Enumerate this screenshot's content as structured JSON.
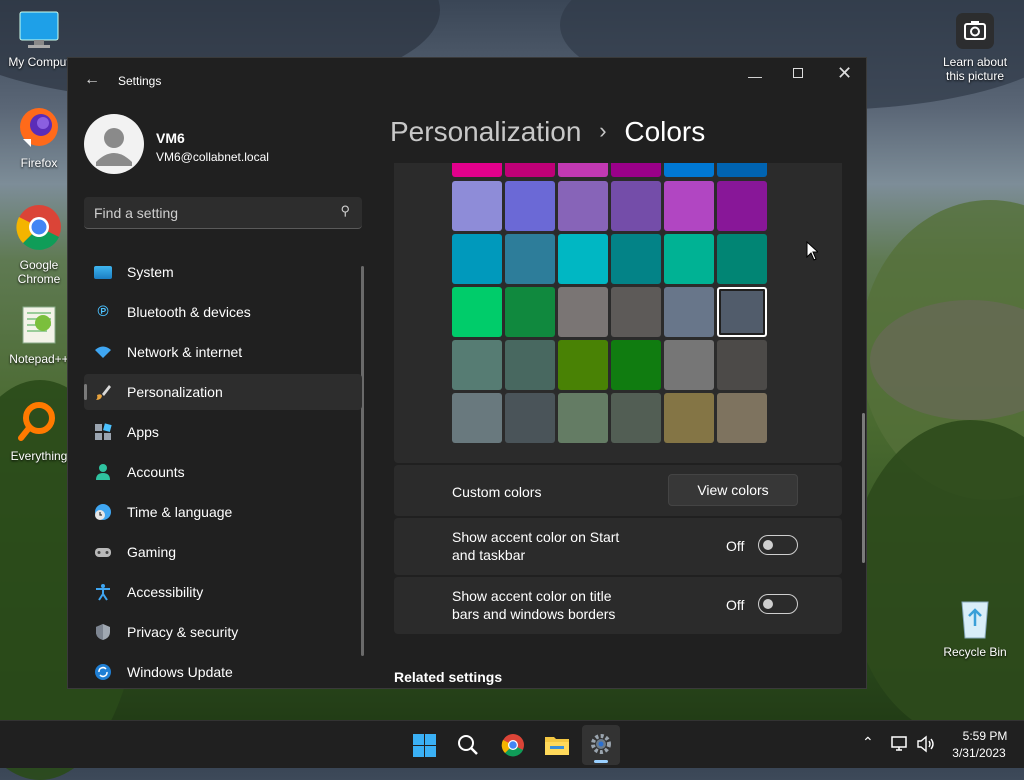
{
  "desktop": {
    "icons": [
      {
        "label": "My Comput"
      },
      {
        "label": "Firefox"
      },
      {
        "label": "Google Chrome"
      },
      {
        "label": "Notepad++"
      },
      {
        "label": "Everything"
      },
      {
        "label": "Learn about this picture"
      },
      {
        "label": "Recycle Bin"
      }
    ]
  },
  "window": {
    "title": "Settings"
  },
  "user": {
    "name": "VM6",
    "email": "VM6@collabnet.local"
  },
  "search": {
    "placeholder": "Find a setting"
  },
  "nav": [
    {
      "label": "System",
      "icon": "system-icon"
    },
    {
      "label": "Bluetooth & devices",
      "icon": "bluetooth-icon"
    },
    {
      "label": "Network & internet",
      "icon": "wifi-icon"
    },
    {
      "label": "Personalization",
      "icon": "brush-icon",
      "selected": true
    },
    {
      "label": "Apps",
      "icon": "apps-icon"
    },
    {
      "label": "Accounts",
      "icon": "person-icon"
    },
    {
      "label": "Time & language",
      "icon": "clock-globe-icon"
    },
    {
      "label": "Gaming",
      "icon": "gamepad-icon"
    },
    {
      "label": "Accessibility",
      "icon": "accessibility-icon"
    },
    {
      "label": "Privacy & security",
      "icon": "shield-icon"
    },
    {
      "label": "Windows Update",
      "icon": "update-icon"
    }
  ],
  "breadcrumb": {
    "parent": "Personalization",
    "separator": "›",
    "current": "Colors"
  },
  "colors": {
    "top_row": [
      "#e3008c",
      "#bf0077",
      "#c239b3",
      "#9a0089",
      "#0078d4",
      "#0063b1"
    ],
    "grid": [
      [
        "#8e8cd8",
        "#6b69d6",
        "#8764b8",
        "#744da9",
        "#b146c2",
        "#881798"
      ],
      [
        "#0099bc",
        "#2d7d9a",
        "#00b7c3",
        "#038387",
        "#00b294",
        "#018574"
      ],
      [
        "#00cc6a",
        "#10893e",
        "#7a7574",
        "#5d5a58",
        "#68768a",
        "#515c6b"
      ],
      [
        "#567c73",
        "#486860",
        "#498205",
        "#107c10",
        "#767676",
        "#4c4a48"
      ],
      [
        "#69797e",
        "#4a5459",
        "#647c64",
        "#525e54",
        "#847545",
        "#7e735f"
      ]
    ],
    "selected": "#515c6b"
  },
  "custom_colors": {
    "label": "Custom colors",
    "button": "View colors"
  },
  "accent_start": {
    "label": "Show accent color on Start and taskbar",
    "state": "Off"
  },
  "accent_title": {
    "label": "Show accent color on title bars and windows borders",
    "state": "Off"
  },
  "related": {
    "heading": "Related settings"
  },
  "taskbar": {
    "time": "5:59 PM",
    "date": "3/31/2023"
  }
}
